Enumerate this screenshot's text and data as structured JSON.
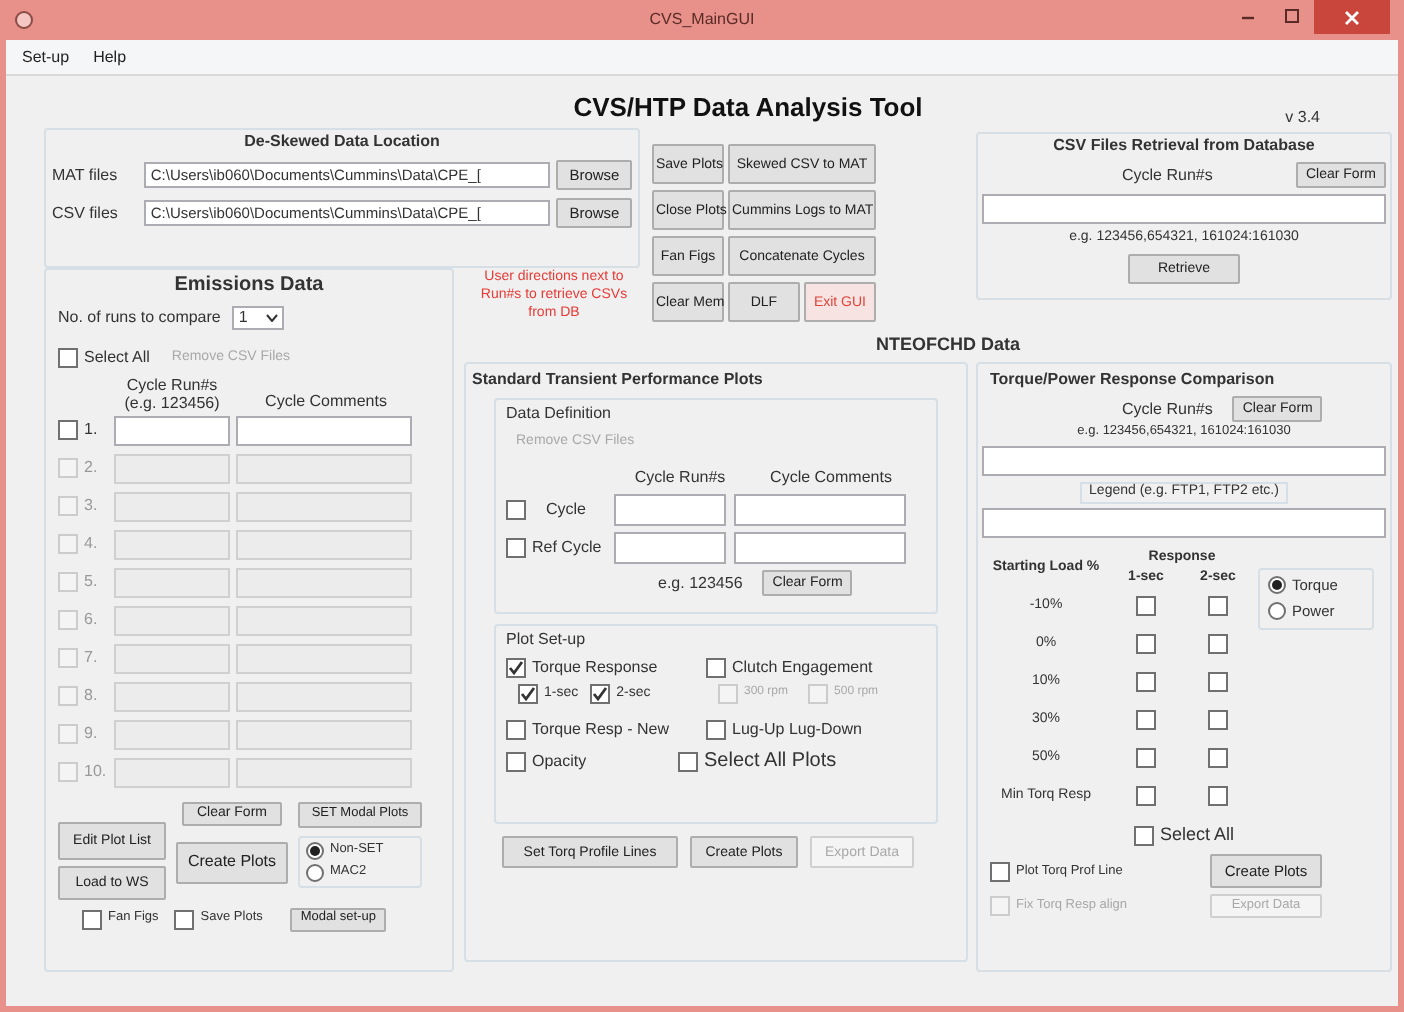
{
  "window": {
    "title": "CVS_MainGUI"
  },
  "menu": [
    {
      "label": "Set-up"
    },
    {
      "label": "Help"
    }
  ],
  "title": "CVS/HTP Data Analysis Tool",
  "version": "v 3.4",
  "deskewed": {
    "title": "De-Skewed Data Location",
    "rows": [
      {
        "label": "MAT files",
        "value": "C:\\Users\\ib060\\Documents\\Cummins\\Data\\CPE_[",
        "button": "Browse"
      },
      {
        "label": "CSV files",
        "value": "C:\\Users\\ib060\\Documents\\Cummins\\Data\\CPE_[",
        "button": "Browse"
      }
    ]
  },
  "tool_buttons": {
    "left": [
      "Save Plots",
      "Close Plots",
      "Fan Figs",
      "Clear Mem"
    ],
    "right": [
      "Skewed CSV to MAT",
      "Cummins Logs to MAT",
      "Concatenate Cycles"
    ],
    "bottom_right": [
      {
        "label": "DLF",
        "kind": "normal"
      },
      {
        "label": "Exit GUI",
        "kind": "danger"
      }
    ]
  },
  "notice": "User directions next to Run#s to retrieve CSVs from DB",
  "csv_retrieval": {
    "title": "CSV Files Retrieval from Database",
    "label": "Cycle Run#s",
    "clear_button": "Clear Form",
    "hint": "e.g. 123456,654321, 161024:161030",
    "button": "Retrieve"
  },
  "emissions": {
    "title": "Emissions Data",
    "runs_label": "No. of runs to compare",
    "runs_value": "1",
    "select_all": {
      "label": "Select All",
      "checked": false
    },
    "remove_button": {
      "label": "Remove CSV Files",
      "disabled": true
    },
    "columns": [
      "Cycle Run#s (e.g. 123456)",
      "Cycle Comments"
    ],
    "rows": [
      {
        "number": "1.",
        "checked": false,
        "disabled": false
      },
      {
        "number": "2.",
        "checked": false,
        "disabled": true
      },
      {
        "number": "3.",
        "checked": false,
        "disabled": true
      },
      {
        "number": "4.",
        "checked": false,
        "disabled": true
      },
      {
        "number": "5.",
        "checked": false,
        "disabled": true
      },
      {
        "number": "6.",
        "checked": false,
        "disabled": true
      },
      {
        "number": "7.",
        "checked": false,
        "disabled": true
      },
      {
        "number": "8.",
        "checked": false,
        "disabled": true
      },
      {
        "number": "9.",
        "checked": false,
        "disabled": true
      },
      {
        "number": "10.",
        "checked": false,
        "disabled": true
      }
    ],
    "edit_button": "Edit Plot List",
    "load_button": "Load to WS",
    "clear_button": "Clear Form",
    "create_button": "Create Plots",
    "set_modal_button": "SET Modal Plots",
    "modes": [
      {
        "label": "Non-SET",
        "selected": true
      },
      {
        "label": "MAC2",
        "selected": false
      }
    ],
    "options": [
      {
        "label": "Fan Figs",
        "checked": false
      },
      {
        "label": "Save Plots",
        "checked": false
      }
    ],
    "modal_button": "Modal set-up"
  },
  "section_title": "NTEOFCHD Data",
  "standard": {
    "title": "Standard Transient Performance Plots",
    "data_definition": {
      "title": "Data Definition",
      "remove_button": {
        "label": "Remove CSV Files",
        "disabled": true
      },
      "columns": [
        "Cycle Run#s",
        "Cycle Comments"
      ],
      "rows": [
        {
          "label": "Cycle",
          "checked": false
        },
        {
          "label": "Ref Cycle",
          "checked": false
        }
      ],
      "hint": "e.g. 123456",
      "clear_button": "Clear Form"
    },
    "plot_setup": {
      "title": "Plot Set-up",
      "options": [
        {
          "label": "Torque Response",
          "checked": true,
          "disabled": false
        },
        {
          "label": "Clutch Engagement",
          "checked": false,
          "disabled": false
        },
        {
          "label": "1-sec",
          "checked": true,
          "disabled": false
        },
        {
          "label": "2-sec",
          "checked": true,
          "disabled": false
        },
        {
          "label": "300 rpm",
          "checked": false,
          "disabled": true
        },
        {
          "label": "500 rpm",
          "checked": false,
          "disabled": true
        },
        {
          "label": "Torque Resp - New",
          "checked": false,
          "disabled": false
        },
        {
          "label": "Lug-Up Lug-Down",
          "checked": false,
          "disabled": false
        },
        {
          "label": "Opacity",
          "checked": false,
          "disabled": false
        },
        {
          "label": "Select All Plots",
          "checked": false,
          "disabled": false
        }
      ]
    },
    "buttons": [
      {
        "label": "Set Torq Profile Lines",
        "disabled": false
      },
      {
        "label": "Create Plots",
        "disabled": false
      },
      {
        "label": "Export Data",
        "disabled": true
      }
    ]
  },
  "comparison": {
    "title": "Torque/Power Response Comparison",
    "label": "Cycle Run#s",
    "clear_button": "Clear Form",
    "hint": "e.g. 123456,654321, 161024:161030",
    "legend_label": "Legend (e.g. FTP1, FTP2 etc.)",
    "load_header": "Starting Load %",
    "response_header": "Response",
    "response_columns": [
      "1-sec",
      "2-sec"
    ],
    "rows": [
      {
        "label": "-10%",
        "one_sec": false,
        "two_sec": false
      },
      {
        "label": "0%",
        "one_sec": false,
        "two_sec": false
      },
      {
        "label": "10%",
        "one_sec": false,
        "two_sec": false
      },
      {
        "label": "30%",
        "one_sec": false,
        "two_sec": false
      },
      {
        "label": "50%",
        "one_sec": false,
        "two_sec": false
      },
      {
        "label": "Min Torq Resp",
        "one_sec": false,
        "two_sec": false
      }
    ],
    "modes": [
      {
        "label": "Torque",
        "selected": true
      },
      {
        "label": "Power",
        "selected": false
      }
    ],
    "select_all": {
      "label": "Select All",
      "checked": false
    },
    "plot_line": {
      "label": "Plot Torq Prof Line",
      "checked": false,
      "disabled": false
    },
    "create_button": {
      "label": "Create Plots",
      "disabled": false
    },
    "align": {
      "label": "Fix Torq Resp align",
      "checked": false,
      "disabled": true
    },
    "export_button": {
      "label": "Export Data",
      "disabled": true
    }
  }
}
